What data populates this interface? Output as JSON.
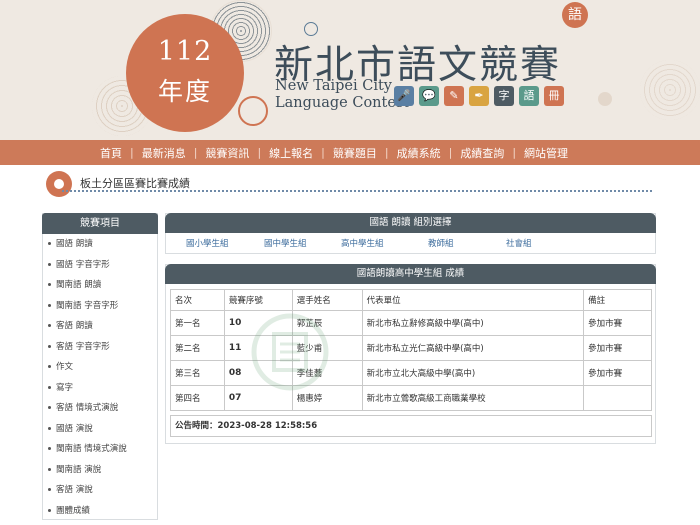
{
  "banner": {
    "year_num": "112",
    "year_word": "年度",
    "title": "新北市語文競賽",
    "title_en_line1": "New Taipei City",
    "title_en_line2": "Language Contest",
    "colors": {
      "accent": "#cf7452",
      "title": "#3d4d5a",
      "background": "#efe9e2"
    },
    "subject_icons": [
      {
        "name": "microphone-icon",
        "color": "#5a7fa3",
        "glyph": "🎤"
      },
      {
        "name": "speech-bubble-icon",
        "color": "#5b9a8b",
        "glyph": "💬"
      },
      {
        "name": "writing-icon",
        "color": "#cf7452",
        "glyph": "✎"
      },
      {
        "name": "pen-icon",
        "color": "#d9a441",
        "glyph": "✒"
      },
      {
        "name": "phonetic-icon",
        "color": "#4e5b63",
        "glyph": "字"
      },
      {
        "name": "chat-icon",
        "color": "#5b9a8b",
        "glyph": "語"
      },
      {
        "name": "book-icon",
        "color": "#cf7452",
        "glyph": "冊"
      }
    ]
  },
  "nav": {
    "items": [
      "首頁",
      "最新消息",
      "競賽資訊",
      "線上報名",
      "競賽題目",
      "成績系統",
      "成績查詢",
      "網站管理"
    ],
    "bg_color": "#cd7a59"
  },
  "section": {
    "title": "板土分區區賽比賽成績"
  },
  "sidebar": {
    "heading": "競賽項目",
    "items": [
      "國語 朗讀",
      "國語 字音字形",
      "閩南語 朗讀",
      "閩南語 字音字形",
      "客語 朗讀",
      "客語 字音字形",
      "作文",
      "寫字",
      "客語 情境式演說",
      "國語 演說",
      "閩南語 情境式演說",
      "閩南語 演說",
      "客語 演說",
      "團體成績"
    ]
  },
  "selector": {
    "heading": "國語 朗讀 組別選擇",
    "links": [
      "國小學生組",
      "國中學生組",
      "高中學生組",
      "教師組",
      "社會組"
    ]
  },
  "results": {
    "heading": "國語朗讀高中學生組 成績",
    "columns": [
      "名次",
      "競賽序號",
      "選手姓名",
      "代表單位",
      "備註"
    ],
    "rows": [
      {
        "rank": "第一名",
        "seq": "10",
        "name": "郭芷辰",
        "unit": "新北市私立辭修高級中學(高中)",
        "note": "參加市賽"
      },
      {
        "rank": "第二名",
        "seq": "11",
        "name": "藍少甫",
        "unit": "新北市私立光仁高級中學(高中)",
        "note": "參加市賽"
      },
      {
        "rank": "第三名",
        "seq": "08",
        "name": "李佳蕎",
        "unit": "新北市立北大高級中學(高中)",
        "note": "參加市賽"
      },
      {
        "rank": "第四名",
        "seq": "07",
        "name": "楊惠婷",
        "unit": "新北市立鶯歌高級工商職業學校",
        "note": ""
      }
    ],
    "announce_label": "公告時間：",
    "announce_time": "2023-08-28 12:58:56"
  }
}
